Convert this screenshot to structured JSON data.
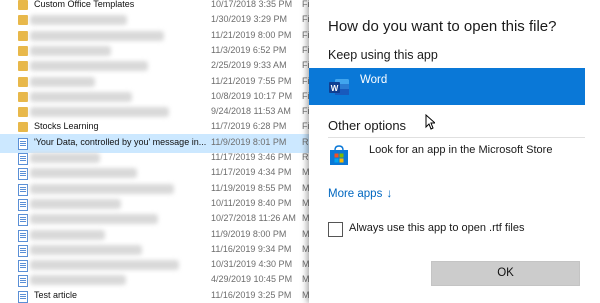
{
  "explorer": {
    "rows": [
      {
        "name": "Custom Office Templates",
        "date": "10/17/2018 3:35 PM",
        "type": "Fil",
        "icon": "folder-icon",
        "blurred": false,
        "partial": true
      },
      {
        "name": "",
        "date": "1/30/2019 3:29 PM",
        "type": "Fil",
        "icon": "folder-icon",
        "blurred": true
      },
      {
        "name": "",
        "date": "11/21/2019 8:00 PM",
        "type": "Fil",
        "icon": "folder-icon",
        "blurred": true
      },
      {
        "name": "",
        "date": "11/3/2019 6:52 PM",
        "type": "Fil",
        "icon": "folder-icon",
        "blurred": true
      },
      {
        "name": "",
        "date": "2/25/2019 9:33 AM",
        "type": "Fil",
        "icon": "folder-icon",
        "blurred": true
      },
      {
        "name": "",
        "date": "11/21/2019 7:55 PM",
        "type": "Fil",
        "icon": "folder-icon",
        "blurred": true
      },
      {
        "name": "",
        "date": "10/8/2019 10:17 PM",
        "type": "Fil",
        "icon": "folder-icon",
        "blurred": true
      },
      {
        "name": "",
        "date": "9/24/2018 11:53 AM",
        "type": "Fil",
        "icon": "folder-icon",
        "blurred": true
      },
      {
        "name": "Stocks Learning",
        "date": "11/7/2019 6:28 PM",
        "type": "Fil",
        "icon": "folder-icon",
        "blurred": false
      },
      {
        "name": "'Your Data, controlled by you' message in...",
        "date": "11/9/2019 8:01 PM",
        "type": "Ri",
        "icon": "document-icon",
        "blurred": false,
        "selected": true
      },
      {
        "name": "",
        "date": "11/17/2019 3:46 PM",
        "type": "Ri",
        "icon": "document-icon",
        "blurred": true
      },
      {
        "name": "",
        "date": "11/17/2019 4:34 PM",
        "type": "M",
        "icon": "document-icon",
        "blurred": true
      },
      {
        "name": "",
        "date": "11/19/2019 8:55 PM",
        "type": "M",
        "icon": "document-icon",
        "blurred": true
      },
      {
        "name": "",
        "date": "10/11/2019 8:40 PM",
        "type": "M",
        "icon": "document-icon",
        "blurred": true
      },
      {
        "name": "",
        "date": "10/27/2018 11:26 AM",
        "type": "M",
        "icon": "document-icon",
        "blurred": true
      },
      {
        "name": "",
        "date": "11/9/2019 8:00 PM",
        "type": "M",
        "icon": "document-icon",
        "blurred": true
      },
      {
        "name": "",
        "date": "11/16/2019 9:34 PM",
        "type": "M",
        "icon": "document-icon",
        "blurred": true
      },
      {
        "name": "",
        "date": "10/31/2019 4:30 PM",
        "type": "M",
        "icon": "document-icon",
        "blurred": true
      },
      {
        "name": "",
        "date": "4/29/2019 10:45 PM",
        "type": "M",
        "icon": "document-icon",
        "blurred": true
      },
      {
        "name": "Test article",
        "date": "11/16/2019 3:25 PM",
        "type": "M",
        "icon": "document-icon",
        "blurred": false,
        "partial": true
      }
    ]
  },
  "dialog": {
    "title": "How do you want to open this file?",
    "keep_using_label": "Keep using this app",
    "word_app": {
      "label": "Word",
      "icon": "word-icon",
      "accent": "#0a78d7"
    },
    "other_options_label": "Other options",
    "store_item": {
      "label": "Look for an app in the Microsoft Store",
      "icon": "microsoft-store-icon"
    },
    "more_apps_label": "More apps",
    "more_apps_icon": "arrow-down-icon",
    "always_use_label": "Always use this app to open .rtf files",
    "always_use_checked": false,
    "ok_label": "OK"
  },
  "colors": {
    "accent": "#0a78d7",
    "link": "#0067c0",
    "ok_button_bg": "#cccccc"
  }
}
